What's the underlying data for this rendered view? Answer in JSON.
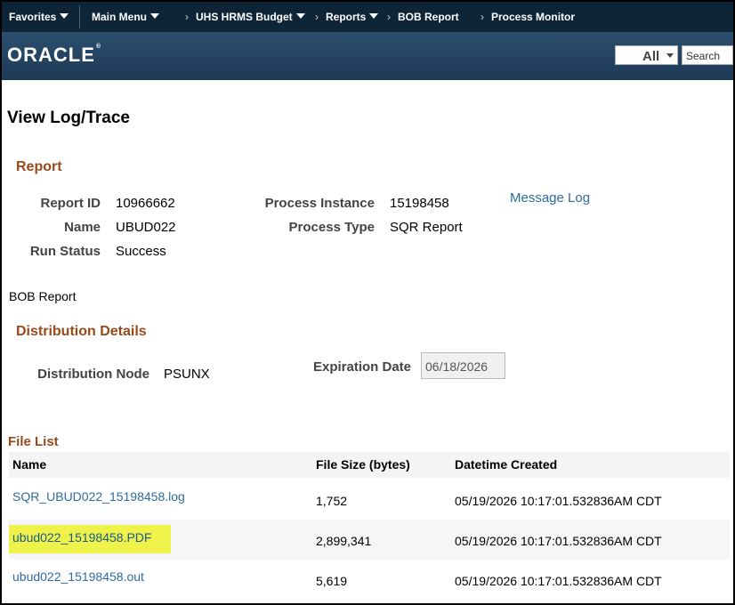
{
  "nav": {
    "favorites": "Favorites",
    "main_menu": "Main Menu",
    "crumbs": [
      "UHS HRMS Budget",
      "Reports",
      "BOB Report",
      "Process Monitor"
    ]
  },
  "banner": {
    "logo": "ORACLE",
    "search_scope": "All",
    "search_placeholder": "Search"
  },
  "page": {
    "title": "View Log/Trace"
  },
  "report": {
    "section_title": "Report",
    "report_id_label": "Report ID",
    "report_id": "10966662",
    "name_label": "Name",
    "name": "UBUD022",
    "run_status_label": "Run Status",
    "run_status": "Success",
    "process_instance_label": "Process Instance",
    "process_instance": "15198458",
    "process_type_label": "Process Type",
    "process_type": "SQR Report",
    "message_log": "Message Log",
    "description": "BOB Report"
  },
  "distribution": {
    "section_title": "Distribution Details",
    "node_label": "Distribution Node",
    "node": "PSUNX",
    "expiration_label": "Expiration Date",
    "expiration": "06/18/2026"
  },
  "file_list": {
    "title": "File List",
    "columns": [
      "Name",
      "File Size (bytes)",
      "Datetime Created"
    ],
    "rows": [
      {
        "name": "SQR_UBUD022_15198458.log",
        "size": "1,752",
        "created": "05/19/2026 10:17:01.532836AM CDT"
      },
      {
        "name": "ubud022_15198458.PDF",
        "size": "2,899,341",
        "created": "05/19/2026 10:17:01.532836AM CDT"
      },
      {
        "name": "ubud022_15198458.out",
        "size": "5,619",
        "created": "05/19/2026 10:17:01.532836AM CDT"
      }
    ]
  },
  "colors": {
    "nav_bg": "#0d2537",
    "banner_bg": "#2c4e6e",
    "section_title": "#974a1c",
    "link": "#2e6b9e",
    "highlight": "#eef24a"
  }
}
